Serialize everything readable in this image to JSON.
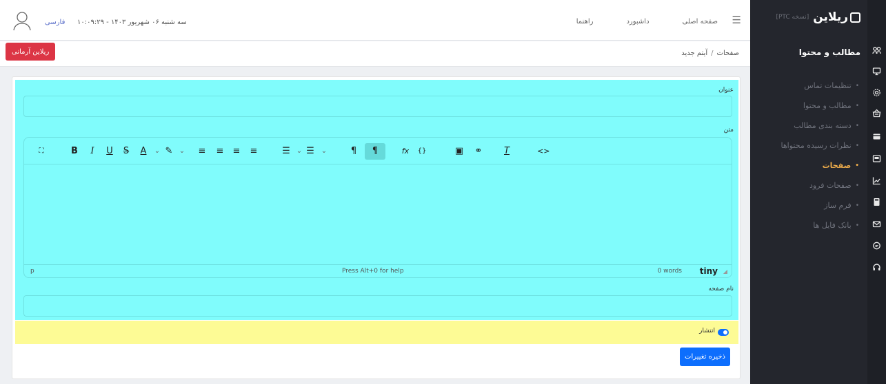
{
  "sidebar": {
    "brand": "ریلاین",
    "version": "[نسخه PTC]",
    "section_title": "مطالب و محتوا",
    "items": [
      {
        "label": "تنظیمات تماس",
        "active": false
      },
      {
        "label": "مطالب و محتوا",
        "active": false
      },
      {
        "label": "دسته بندی مطالب",
        "active": false
      },
      {
        "label": "نظرات رسیده محتواها",
        "active": false
      },
      {
        "label": "صفحات",
        "active": true
      },
      {
        "label": "صفحات فرود",
        "active": false
      },
      {
        "label": "فرم ساز",
        "active": false
      },
      {
        "label": "بانک فایل ها",
        "active": false
      }
    ],
    "icons": [
      "users-icon",
      "monitor-icon",
      "gear-icon",
      "shop-icon",
      "card-icon",
      "window-icon",
      "chart-icon",
      "calculator-icon",
      "mail-icon",
      "chat-icon",
      "headset-icon"
    ]
  },
  "topbar": {
    "nav": [
      "صفحه اصلی",
      "داشبورد",
      "راهنما"
    ],
    "datetime": "سه شنبه ۰۶ شهریور ۱۴۰۳ - ۱۰:۰۹:۲۹",
    "lang": "فارسی"
  },
  "breadcrumb": {
    "parent": "صفحات",
    "separator": "/",
    "current": "آیتم جدید"
  },
  "demo_button": "ریلاین آرمانی",
  "form": {
    "title_label": "عنوان",
    "text_label": "متن",
    "page_name_label": "نام صفحه",
    "publish_label": "انتشار",
    "publish_on": true,
    "save_label": "ذخیره تغییرات"
  },
  "editor": {
    "toolbar": [
      "⛶",
      "B",
      "I",
      "U",
      "S",
      "A",
      "✎",
      "≡",
      "≡",
      "≡",
      "≡",
      "☰",
      "☰",
      "¶",
      "¶",
      "fx",
      "{}",
      "🖼",
      "🔗",
      "Tx",
      "<>"
    ],
    "status_path": "p",
    "help": "Press Alt+0 for help",
    "words": "0 words",
    "brand": "tiny"
  }
}
